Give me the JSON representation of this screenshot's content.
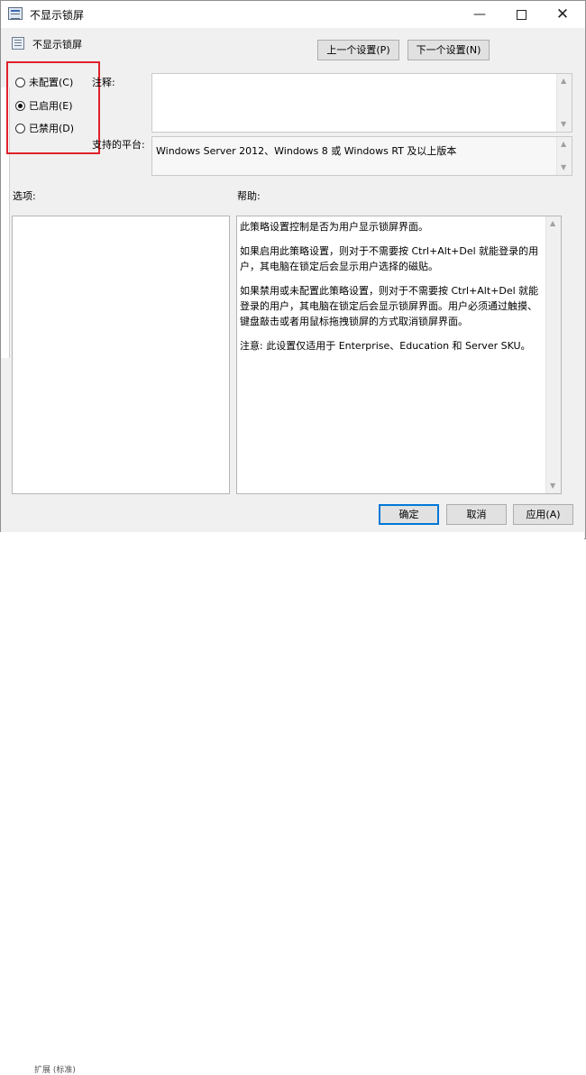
{
  "window": {
    "title": "不显示锁屏",
    "minimize_glyph": "—",
    "close_glyph": "✕"
  },
  "policy_name": "不显示锁屏",
  "nav": {
    "prev_label": "上一个设置(P)",
    "next_label": "下一个设置(N)"
  },
  "state_options": [
    {
      "label": "未配置(C)",
      "checked": false
    },
    {
      "label": "已启用(E)",
      "checked": true
    },
    {
      "label": "已禁用(D)",
      "checked": false
    }
  ],
  "labels": {
    "comment": "注释:",
    "supported_on": "支持的平台:",
    "options": "选项:",
    "help": "帮助:"
  },
  "comment_value": "",
  "supported_on_value": "Windows Server 2012、Windows 8 或 Windows RT 及以上版本",
  "help_paragraphs": [
    "此策略设置控制是否为用户显示锁屏界面。",
    "如果启用此策略设置，则对于不需要按 Ctrl+Alt+Del 就能登录的用户，其电脑在锁定后会显示用户选择的磁贴。",
    "如果禁用或未配置此策略设置，则对于不需要按 Ctrl+Alt+Del 就能登录的用户，其电脑在锁定后会显示锁屏界面。用户必须通过触摸、键盘敲击或者用鼠标拖拽锁屏的方式取消锁屏界面。",
    "注意: 此设置仅适用于 Enterprise、Education 和 Server SKU。"
  ],
  "footer": {
    "ok_label": "确定",
    "cancel_label": "取消",
    "apply_label": "应用(A)"
  },
  "background_partial_text": "扩展 (标准)",
  "highlight_color": "#e0212a",
  "icons": [
    "policy-icon",
    "radio-icon",
    "scroll-up-icon",
    "scroll-down-icon"
  ]
}
